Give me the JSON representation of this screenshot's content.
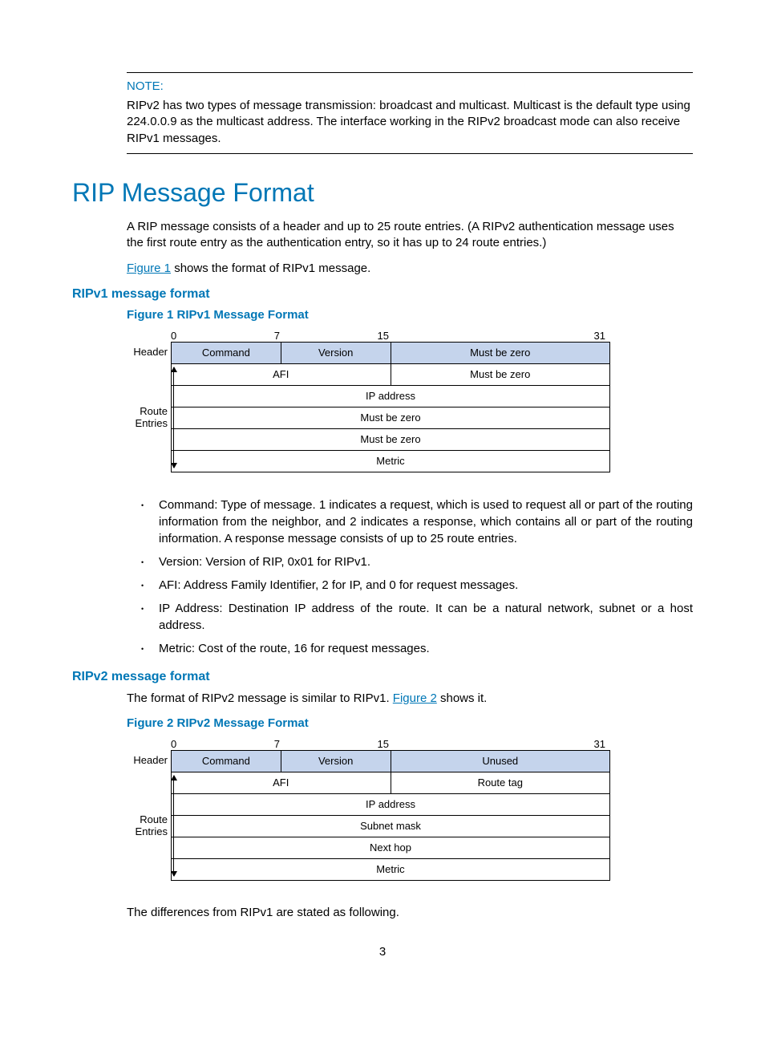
{
  "note": {
    "label": "NOTE:",
    "text": "RIPv2 has two types of message transmission: broadcast and multicast. Multicast is the default type using 224.0.0.9 as the multicast address. The interface working in the RIPv2 broadcast mode can also receive RIPv1 messages."
  },
  "section_title": "RIP Message Format",
  "intro_para": "A RIP message consists of a header and up to 25 route entries. (A RIPv2 authentication message uses the first route entry as the authentication entry, so it has up to 24 route entries.)",
  "fig1_ref_pre": "",
  "fig1_link": "Figure 1",
  "fig1_ref_post": " shows the format of RIPv1 message.",
  "ripv1_heading": "RIPv1 message format",
  "fig1_caption": "Figure 1 RIPv1 Message Format",
  "bits": {
    "b0": "0",
    "b7": "7",
    "b15": "15",
    "b31": "31"
  },
  "labels": {
    "header": "Header",
    "route": "Route",
    "entries": "Entries"
  },
  "fig1": {
    "r1c1": "Command",
    "r1c2": "Version",
    "r1c3": "Must be zero",
    "r2c1": "AFI",
    "r2c2": "Must be zero",
    "r3": "IP address",
    "r4": "Must be zero",
    "r5": "Must be zero",
    "r6": "Metric"
  },
  "ripv1_bullets": [
    "Command: Type of message. 1 indicates a request, which is used to request all or part of the routing information from the neighbor, and 2 indicates a response, which contains all or part of the routing information. A response message consists of up to 25 route entries.",
    "Version: Version of RIP, 0x01 for RIPv1.",
    "AFI: Address Family Identifier, 2 for IP, and 0 for request messages.",
    "IP Address: Destination IP address of the route. It can be a natural network, subnet or a host address.",
    "Metric: Cost of the route, 16 for request messages."
  ],
  "ripv2_heading": "RIPv2 message format",
  "ripv2_intro_pre": "The format of RIPv2 message is similar to RIPv1. ",
  "fig2_link": "Figure 2",
  "ripv2_intro_post": " shows it.",
  "fig2_caption": "Figure 2 RIPv2 Message Format",
  "fig2": {
    "r1c1": "Command",
    "r1c2": "Version",
    "r1c3": "Unused",
    "r2c1": "AFI",
    "r2c2": "Route tag",
    "r3": "IP address",
    "r4": "Subnet mask",
    "r5": "Next hop",
    "r6": "Metric"
  },
  "diff_para": "The differences from RIPv1 are stated as following.",
  "page_number": "3"
}
